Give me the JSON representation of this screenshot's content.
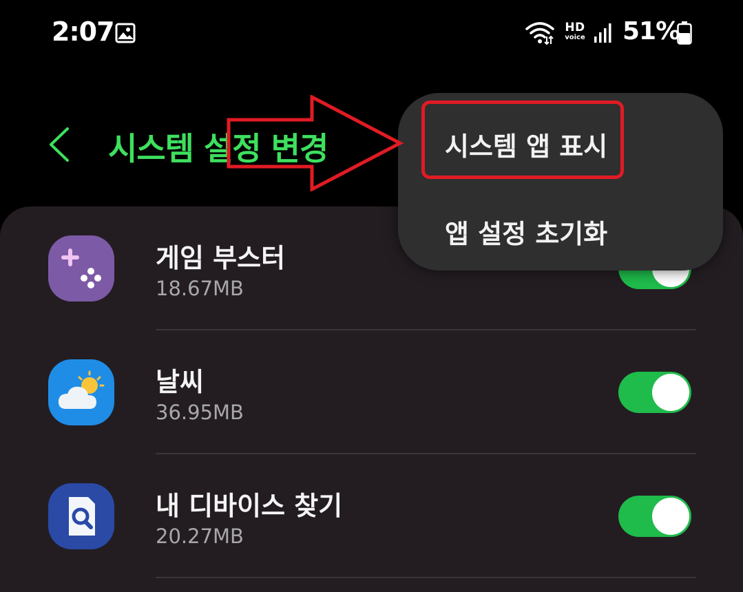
{
  "status_bar": {
    "time": "2:07",
    "hd_label": "HD",
    "voice_label": "voice",
    "battery_percent": "51%",
    "icons": [
      "gallery-icon",
      "wifi-icon",
      "hd-voice-icon",
      "signal-icon",
      "battery-icon"
    ]
  },
  "header": {
    "title": "시스템 설정 변경",
    "title_color": "#3ee05e"
  },
  "apps": [
    {
      "name": "게임 부스터",
      "size": "18.67MB",
      "enabled": true,
      "icon": "game-booster-icon"
    },
    {
      "name": "날씨",
      "size": "36.95MB",
      "enabled": true,
      "icon": "weather-icon"
    },
    {
      "name": "내 디바이스 찾기",
      "size": "20.27MB",
      "enabled": true,
      "icon": "find-my-device-icon"
    }
  ],
  "menu": {
    "items": [
      {
        "label": "시스템 앱 표시",
        "highlighted": true
      },
      {
        "label": "앱 설정 초기화",
        "highlighted": false
      }
    ]
  },
  "colors": {
    "toggle_on": "#1fbb4b",
    "highlight": "#e01b24",
    "card_background": "#231d22"
  }
}
